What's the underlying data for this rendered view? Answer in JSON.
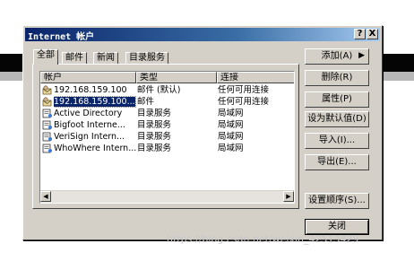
{
  "window": {
    "title": "Internet 帐户",
    "help_label": "?",
    "close_label": "X"
  },
  "tabs": [
    {
      "label": "全部"
    },
    {
      "label": "邮件"
    },
    {
      "label": "新闻"
    },
    {
      "label": "目录服务"
    }
  ],
  "list": {
    "columns": [
      "帐户",
      "类型",
      "连接"
    ],
    "rows": [
      {
        "name": "192.168.159.100",
        "type": "邮件 (默认)",
        "connection": "任何可用连接",
        "icon": "mail-account-icon"
      },
      {
        "name": "192.168.159.100...",
        "type": "邮件",
        "connection": "任何可用连接",
        "icon": "mail-account-icon",
        "selected": true
      },
      {
        "name": "Active Directory",
        "type": "目录服务",
        "connection": "局域网",
        "icon": "directory-service-icon"
      },
      {
        "name": "Bigfoot Interne...",
        "type": "目录服务",
        "connection": "局域网",
        "icon": "directory-service-icon"
      },
      {
        "name": "VeriSign Intern...",
        "type": "目录服务",
        "connection": "局域网",
        "icon": "directory-service-icon"
      },
      {
        "name": "WhoWhere Intern...",
        "type": "目录服务",
        "connection": "局域网",
        "icon": "directory-service-icon"
      }
    ]
  },
  "buttons": {
    "add": "添加(A)",
    "add_arrow": "▶",
    "delete": "删除(R)",
    "properties": "属性(P)",
    "set_default": "设为默认值(D)",
    "import": "导入(I)...",
    "export": "导出(E)...",
    "set_order": "设置顺序(S)...",
    "close": "关闭"
  },
  "scrollbar": {
    "left_arrow": "◀",
    "right_arrow": "▶"
  },
  "watermark": "https://blog.csdn.net/weixin_42513429",
  "colors": {
    "dialog_bg": "#d4d0c8",
    "title_start": "#0a246a",
    "selection": "#0a246a"
  }
}
